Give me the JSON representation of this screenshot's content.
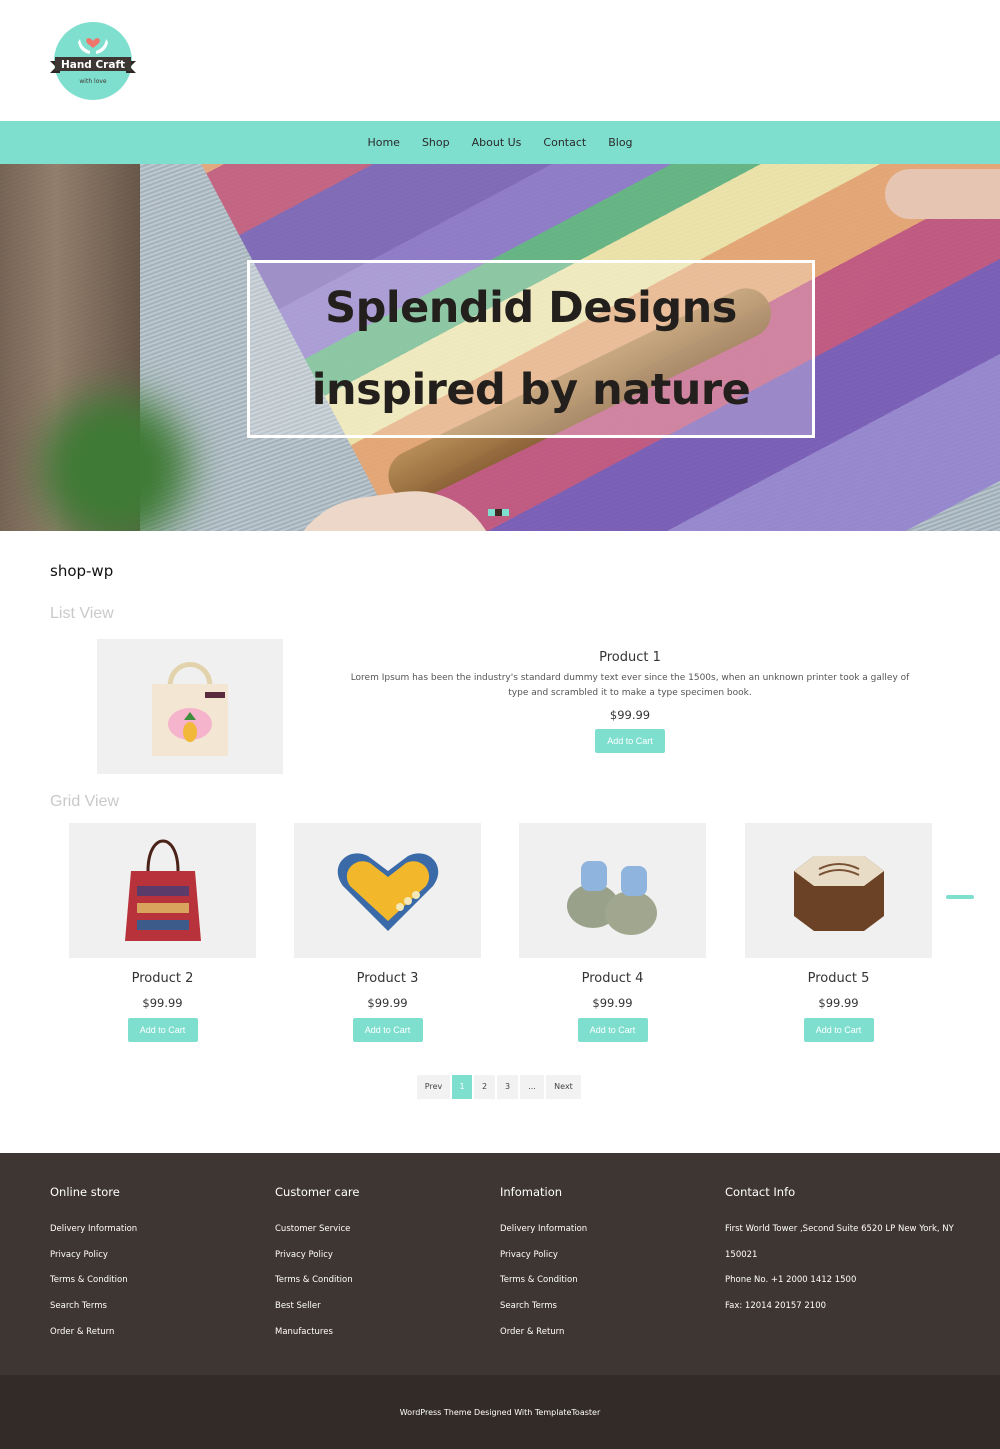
{
  "logo": {
    "title": "Hand Craft",
    "tagline": "with love",
    "icon": "heart-hands-icon"
  },
  "nav": {
    "items": [
      {
        "label": "Home"
      },
      {
        "label": "Shop"
      },
      {
        "label": "About Us"
      },
      {
        "label": "Contact"
      },
      {
        "label": "Blog"
      }
    ]
  },
  "hero": {
    "line1": "Splendid Designs",
    "line2": "inspired by nature",
    "slides": 3,
    "active_slide": 2
  },
  "page": {
    "site_title": "shop-wp",
    "list_view_label": "List View",
    "grid_view_label": "Grid View"
  },
  "list_product": {
    "name": "Product 1",
    "description": "Lorem Ipsum has been the industry's standard dummy text ever since the 1500s, when an unknown printer took a galley of type and scrambled it to make a type specimen book.",
    "price": "$99.99",
    "button": "Add to Cart",
    "image": "tote-bag-image"
  },
  "grid_products": [
    {
      "name": "Product 2",
      "price": "$99.99",
      "button": "Add to Cart",
      "image": "handbag-image"
    },
    {
      "name": "Product 3",
      "price": "$99.99",
      "button": "Add to Cart",
      "image": "heart-box-image"
    },
    {
      "name": "Product 4",
      "price": "$99.99",
      "button": "Add to Cart",
      "image": "baby-booties-image"
    },
    {
      "name": "Product 5",
      "price": "$99.99",
      "button": "Add to Cart",
      "image": "wooden-box-image"
    }
  ],
  "pagination": {
    "prev": "Prev",
    "pages": [
      "1",
      "2",
      "3",
      "..."
    ],
    "active": "1",
    "next": "Next"
  },
  "footer": {
    "columns": [
      {
        "title": "Online store",
        "links": [
          "Delivery Information",
          "Privacy Policy",
          "Terms & Condition",
          "Search Terms",
          "Order & Return"
        ]
      },
      {
        "title": "Customer care",
        "links": [
          "Customer Service",
          "Privacy Policy",
          "Terms & Condition",
          "Best Seller",
          "Manufactures"
        ]
      },
      {
        "title": "Infomation",
        "links": [
          "Delivery Information",
          "Privacy Policy",
          "Terms & Condition",
          "Search Terms",
          "Order & Return"
        ]
      }
    ],
    "contact": {
      "title": "Contact Info",
      "address": "First World Tower ,Second Suite 6520 LP New York, NY 150021",
      "phone": "Phone No. +1 2000 1412 1500",
      "fax": "Fax: 12014 20157 2100"
    },
    "copyright": "WordPress Theme Designed With TemplateToaster"
  },
  "colors": {
    "accent": "#7fdfcf",
    "footer_bg": "#3e3632",
    "copyright_bg": "#322b27",
    "logo_banner": "#3e3632",
    "heart": "#f0766b"
  }
}
